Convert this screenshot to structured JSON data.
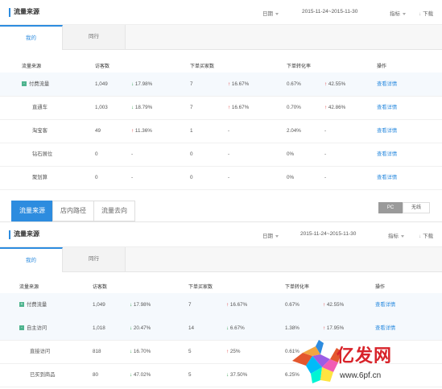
{
  "colors": {
    "accent": "#2d8cdf",
    "up": "#e03a3a",
    "down": "#2ca04a",
    "tag": "#4fb48f"
  },
  "panel1": {
    "title": "流量来源",
    "date_label": "日期",
    "date_range": "2015-11-24~2015-11-30",
    "metric_label": "指标",
    "download_label": "下载",
    "tabs": [
      "我的",
      "同行"
    ],
    "columns": [
      "流量来源",
      "访客数",
      "下单买家数",
      "下单转化率",
      "操作"
    ],
    "rows": [
      {
        "name": "付费流量",
        "tag": "-",
        "visitors": "1,049",
        "v_trend": "17.98%",
        "v_dir": "down",
        "buyers": "7",
        "b_trend": "16.67%",
        "b_dir": "up",
        "rate": "0.67%",
        "r_trend": "42.55%",
        "r_dir": "up",
        "op": "查看详情"
      },
      {
        "name": "直通车",
        "visitors": "1,003",
        "v_trend": "18.79%",
        "v_dir": "down",
        "buyers": "7",
        "b_trend": "16.67%",
        "b_dir": "up",
        "rate": "0.70%",
        "r_trend": "42.86%",
        "r_dir": "up",
        "op": "查看详情"
      },
      {
        "name": "淘宝客",
        "visitors": "49",
        "v_trend": "11.36%",
        "v_dir": "up",
        "buyers": "1",
        "b_trend": "-",
        "rate": "2.04%",
        "r_trend": "-",
        "op": "查看详情"
      },
      {
        "name": "钻石展位",
        "visitors": "0",
        "v_trend": "-",
        "buyers": "0",
        "b_trend": "-",
        "rate": "0%",
        "r_trend": "-",
        "op": "查看详情"
      },
      {
        "name": "聚划算",
        "visitors": "0",
        "v_trend": "-",
        "buyers": "0",
        "b_trend": "-",
        "rate": "0%",
        "r_trend": "-",
        "op": "查看详情"
      }
    ]
  },
  "nav": {
    "tabs": [
      "流量来源",
      "店内路径",
      "流量去向"
    ],
    "device": [
      "PC",
      "无线"
    ]
  },
  "panel2": {
    "title": "流量来源",
    "date_label": "日期",
    "date_range": "2015-11-24~2015-11-30",
    "metric_label": "指标",
    "download_label": "下载",
    "tabs": [
      "我的",
      "同行"
    ],
    "columns": [
      "流量来源",
      "访客数",
      "下单买家数",
      "下单转化率",
      "操作"
    ],
    "rows": [
      {
        "name": "付费流量",
        "tag": "+",
        "visitors": "1,049",
        "v_trend": "17.98%",
        "v_dir": "down",
        "buyers": "7",
        "b_trend": "16.67%",
        "b_dir": "up",
        "rate": "0.67%",
        "r_trend": "42.55%",
        "r_dir": "up",
        "op": "查看详情"
      },
      {
        "name": "自主访问",
        "tag": "-",
        "visitors": "1,018",
        "v_trend": "20.47%",
        "v_dir": "down",
        "buyers": "14",
        "b_trend": "6.67%",
        "b_dir": "down",
        "rate": "1.38%",
        "r_trend": "17.95%",
        "r_dir": "up",
        "op": "查看详情"
      },
      {
        "name": "直接访问",
        "visitors": "818",
        "v_trend": "16.70%",
        "v_dir": "down",
        "buyers": "5",
        "b_trend": "25%",
        "b_dir": "up",
        "rate": "0.61%",
        "r_trend": "",
        "op": ""
      },
      {
        "name": "已买到商品",
        "visitors": "80",
        "v_trend": "47.02%",
        "v_dir": "down",
        "buyers": "5",
        "b_trend": "37.50%",
        "b_dir": "down",
        "rate": "6.25%",
        "r_trend": "",
        "op": ""
      }
    ]
  },
  "watermark": {
    "brand": "亿发网",
    "url": "www.6pf.cn"
  }
}
